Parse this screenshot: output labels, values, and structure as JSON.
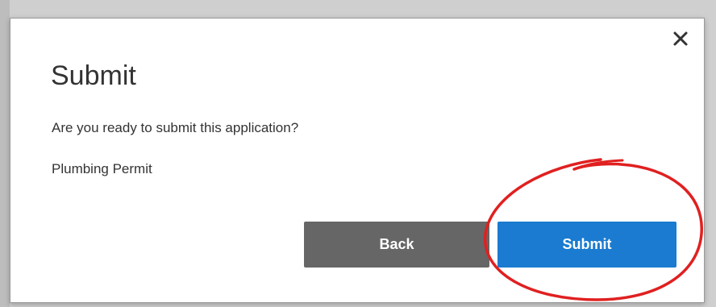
{
  "dialog": {
    "title": "Submit",
    "message": "Are you ready to submit this application?",
    "subject": "Plumbing Permit",
    "close_icon": "close-icon",
    "back_label": "Back",
    "submit_label": "Submit"
  },
  "colors": {
    "back_button": "#666666",
    "submit_button": "#1a7bd0",
    "annotation": "#e02020"
  }
}
